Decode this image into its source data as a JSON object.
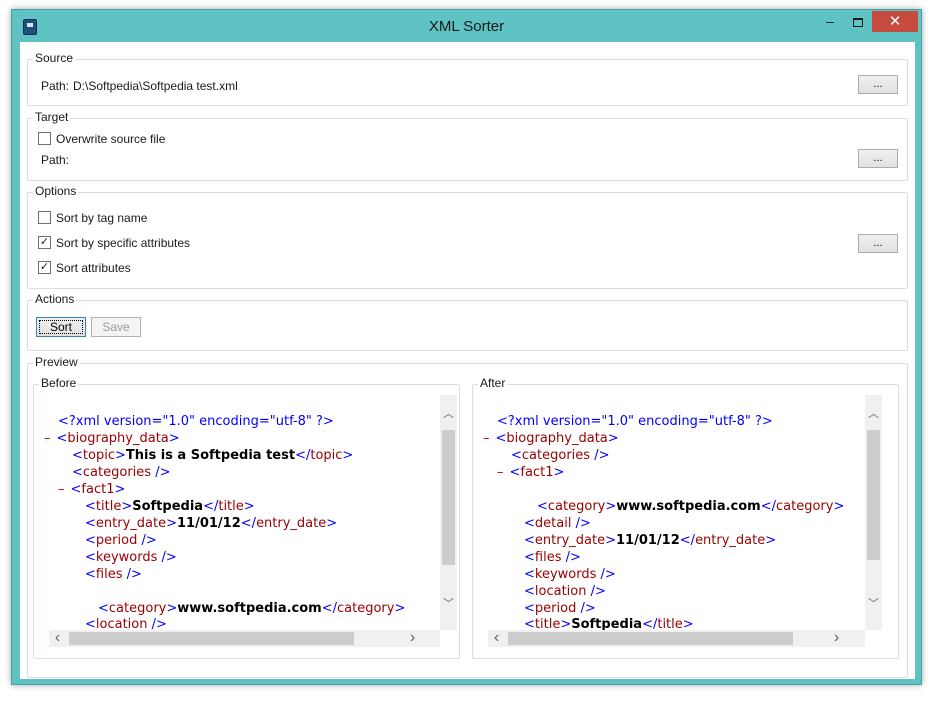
{
  "window": {
    "title": "XML Sorter",
    "close_glyph": "✕",
    "min_glyph": "–"
  },
  "source": {
    "label": "Source",
    "path_label": "Path:",
    "path_value": "D:\\Softpedia\\Softpedia test.xml",
    "browse_label": "..."
  },
  "target": {
    "label": "Target",
    "overwrite_label": "Overwrite source file",
    "overwrite_checked": false,
    "path_label": "Path:",
    "browse_label": "..."
  },
  "options": {
    "label": "Options",
    "sort_tag_name_label": "Sort by tag name",
    "sort_tag_name_checked": false,
    "sort_specific_label": "Sort by specific attributes",
    "sort_specific_checked": true,
    "sort_attributes_label": "Sort attributes",
    "sort_attributes_checked": true,
    "browse_label": "..."
  },
  "actions": {
    "label": "Actions",
    "sort_label": "Sort",
    "save_label": "Save"
  },
  "preview": {
    "label": "Preview",
    "before": {
      "label": "Before",
      "lines": [
        {
          "type": "pi",
          "text": "<?xml version=\"1.0\" encoding=\"utf-8\" ?>"
        },
        {
          "type": "open",
          "minus": "–",
          "tag": "biography_data"
        },
        {
          "type": "elem",
          "tag": "topic",
          "value": "This is a Softpedia test"
        },
        {
          "type": "empty",
          "tag": "categories"
        },
        {
          "type": "open",
          "minus": "–",
          "tag": "fact1"
        },
        {
          "type": "elem",
          "tag": "title",
          "value": "Softpedia"
        },
        {
          "type": "elem",
          "tag": "entry_date",
          "value": "11/01/12"
        },
        {
          "type": "empty",
          "tag": "period"
        },
        {
          "type": "empty",
          "tag": "keywords"
        },
        {
          "type": "empty",
          "tag": "files"
        },
        {
          "type": "elem",
          "tag": "category",
          "value": "www.softpedia.com"
        },
        {
          "type": "empty",
          "tag": "location"
        }
      ]
    },
    "after": {
      "label": "After",
      "lines": [
        {
          "type": "pi",
          "text": "<?xml version=\"1.0\" encoding=\"utf-8\" ?>"
        },
        {
          "type": "open",
          "minus": "–",
          "tag": "biography_data"
        },
        {
          "type": "empty",
          "tag": "categories"
        },
        {
          "type": "open",
          "minus": "–",
          "tag": "fact1"
        },
        {
          "type": "elem",
          "tag": "category",
          "value": "www.softpedia.com"
        },
        {
          "type": "empty",
          "tag": "detail"
        },
        {
          "type": "elem",
          "tag": "entry_date",
          "value": "11/01/12"
        },
        {
          "type": "empty",
          "tag": "files"
        },
        {
          "type": "empty",
          "tag": "keywords"
        },
        {
          "type": "empty",
          "tag": "location"
        },
        {
          "type": "empty",
          "tag": "period"
        },
        {
          "type": "elem",
          "tag": "title",
          "value": "Softpedia"
        }
      ]
    }
  },
  "scroll_glyphs": {
    "up": "︿",
    "down": "﹀",
    "left": "‹",
    "right": "›"
  },
  "colors": {
    "window_frame": "#5fc3c4",
    "close_button": "#c74a3f",
    "xml_tag": "#990000",
    "xml_bracket": "#0000ff"
  }
}
